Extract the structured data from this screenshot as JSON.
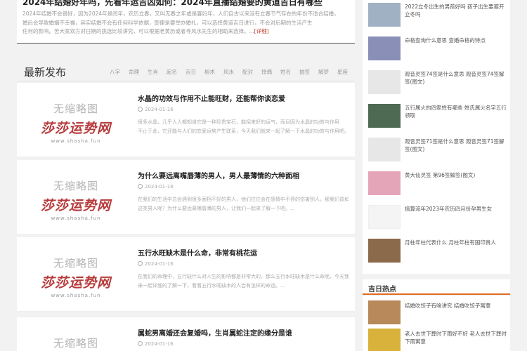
{
  "top_article": {
    "title": "2024年结婚好年吗，先看年运吉凶如何：2024年直播结婚要的黄道吉日有哪些",
    "lines": [
      "2024年结婚不会很好，因为2024年是闰年，农历立春，又叫无春之年或是寡妇年，人们自古以来没有立春节气存在的年份不适合结婚，",
      "婚后会导致婚姻不幸福，其实结婚不会有任何科学依据，即便是要举办婚礼，可以选择黄道吉日进行，不会对后期的生活产生",
      "任何的影响。苦大家双方对日期的挑选比较讲究，可以根据老黄历或者寻风水先生的相助来选择。..."
    ],
    "more": "[详细]"
  },
  "section": {
    "title": "最新发布",
    "tabs": [
      "八字",
      "命理",
      "生肖",
      "起名",
      "吉日",
      "相术",
      "风水",
      "配对",
      "择偶",
      "姓名",
      "抽签",
      "解梦",
      "星座"
    ]
  },
  "thumb": {
    "top": "无缩略图",
    "logo": "莎莎运势网",
    "url": "www.shasha.fun"
  },
  "articles": [
    {
      "title": "水晶的功效与作用不止能旺财，还能帮你谈恋爱",
      "date": "2024-01-16",
      "lines": [
        "很多水晶，几乎人人都知道它是一种珍贵宝石，能招来好的运气，而且因为水晶的功效与作用",
        "不止于此，它还能与人们的恋爱运势产生联系，今天我们就来一起了解一下水晶的功效与作用吧。..."
      ]
    },
    {
      "title": "为什么要远离嘴唇薄的男人，男人最薄情的六种面相",
      "date": "2024-01-16",
      "lines": [
        "在我们的生活中总会遇到很多面相不好的男人，他们往往会在感情中不停的伤害别人，那我们该如何分辨",
        "这类男人呢？为什么要远离嘴唇薄的男人，让我们一起来了解一下吧。..."
      ]
    },
    {
      "title": "五行水旺缺木是什么命，非常有桃花运",
      "date": "2024-01-16",
      "lines": [
        "在我们的命理中，五行缺什么对人生的影响都是非常大的，那么五行水旺缺木是什么命呢，今天我们就",
        "来一起详细的了解一下，看看五行水旺缺木的人会有怎样的命运。..."
      ]
    },
    {
      "title": "属蛇男离婚还会复婚吗，生肖属蛇注定的缘分是谁",
      "date": "2024-01-16",
      "lines": [
        "",
        ""
      ]
    }
  ],
  "sidebar": {
    "items": [
      {
        "text": "2022立冬出生的男孩好吗 孩子出生要避开立冬吗",
        "color": "#9fb1c2"
      },
      {
        "text": "命格查询什么意思 查婚命格的特点",
        "color": "#8a8fb8"
      },
      {
        "text": "观音灵签74签是什么意思 观音灵签74签解签(图文)",
        "color": "#e7e7e7"
      },
      {
        "text": "五行属火的四家姓有哪些 姓氏属火名字五行领取",
        "color": "#4e6a52"
      },
      {
        "text": "观音灵签71签是什么意思 观音灵签71签解签(图文)",
        "color": "#e7e7e7"
      },
      {
        "text": "黄大仙灵签 第96签解签(图文)",
        "color": "#e5a5b9"
      },
      {
        "text": "搞算流年2023年农历四月份孕男生女",
        "color": "#f4f4f4"
      },
      {
        "text": "月柱年柱代表什么 月柱年柱有国印贵人",
        "color": "#8b6a4b"
      }
    ]
  },
  "hot": {
    "heading": "吉日热点",
    "items": [
      {
        "text": "结婚吃饺子有啥讲究 结婚吃饺子寓意",
        "color": "#b7895b"
      },
      {
        "text": "老人去世下葬时下雨好不好 老人去世下葬时下雨寓意",
        "color": "#d8b23a"
      }
    ]
  },
  "colors": {
    "accent": "#e26c1f",
    "logo_red": "#b73a3a",
    "link_red": "#c0392b"
  }
}
